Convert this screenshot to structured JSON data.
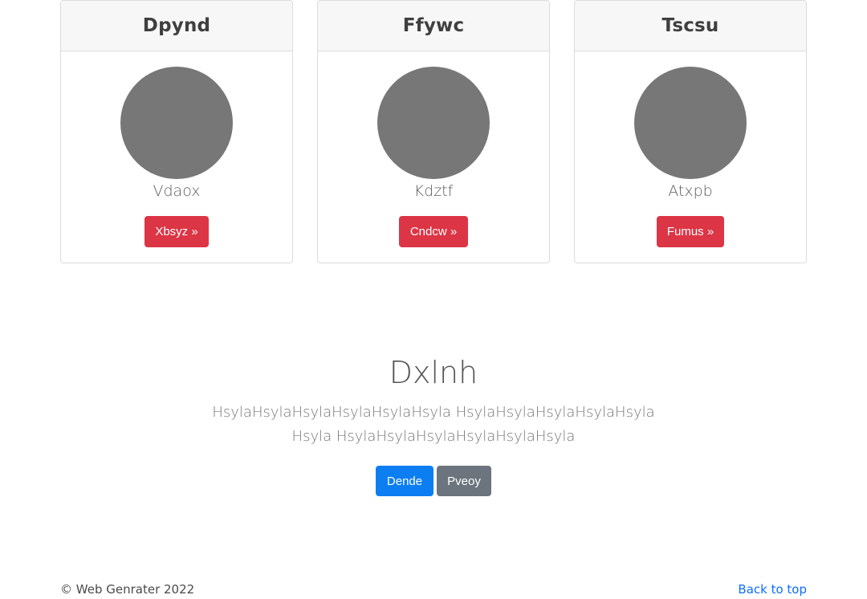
{
  "cards": [
    {
      "title": "Dpynd",
      "text": "Vdaox",
      "button": "Xbsyz »"
    },
    {
      "title": "Ffywc",
      "text": "Kdztf",
      "button": "Cndcw »"
    },
    {
      "title": "Tscsu",
      "text": "Atxpb",
      "button": "Fumus »"
    }
  ],
  "hero": {
    "title": "Dxlnh",
    "body": "HsylaHsylaHsylaHsylaHsylaHsyla HsylaHsylaHsylaHsylaHsylaHsyla HsylaHsylaHsylaHsylaHsylaHsyla",
    "primary_button": "Dende",
    "secondary_button": "Pveoy"
  },
  "footer": {
    "copyright": "© Web Genrater 2022",
    "back_to_top": "Back to top"
  },
  "colors": {
    "card_button": "#dc3545",
    "primary": "#0d7ef2",
    "secondary": "#6c757d",
    "link": "#0d6efd",
    "avatar": "#777777"
  }
}
